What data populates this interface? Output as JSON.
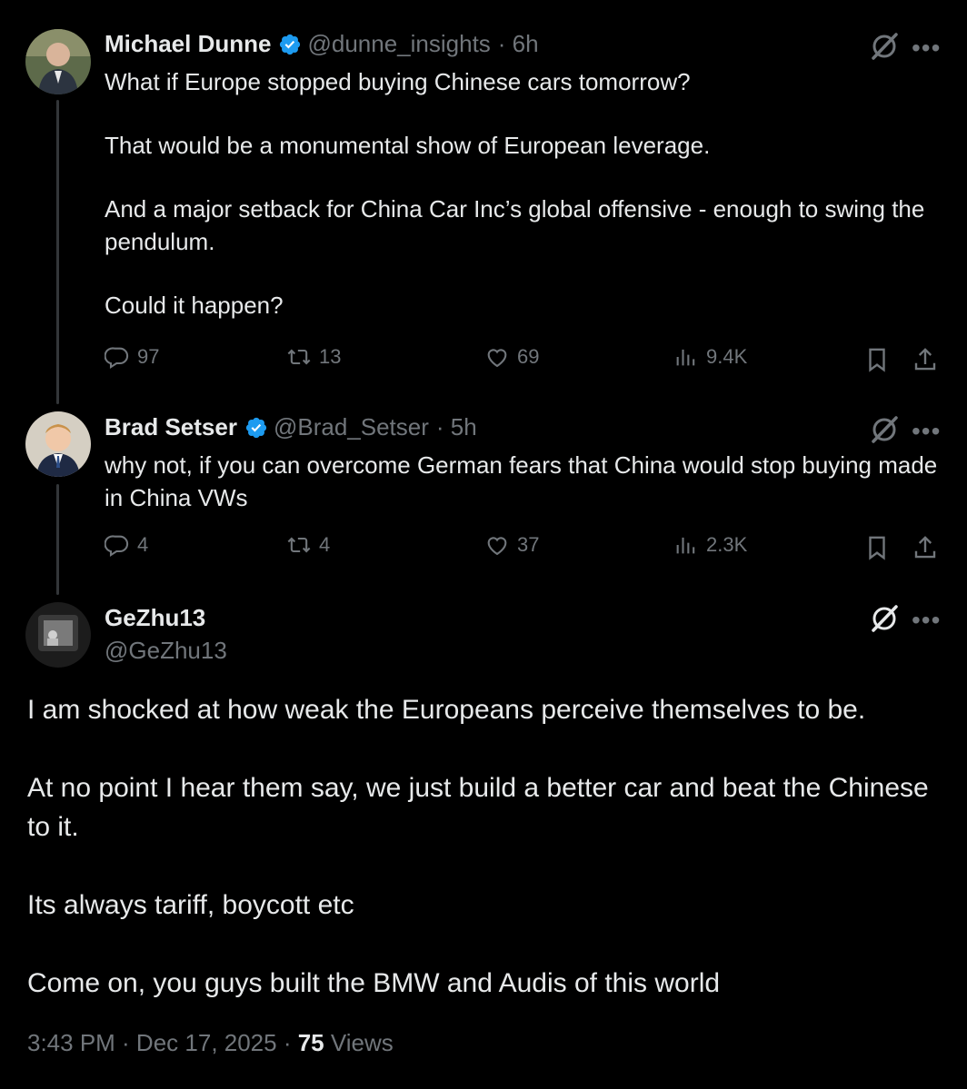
{
  "tweets": [
    {
      "name": "Michael Dunne",
      "handle": "@dunne_insights",
      "time": "· 6h",
      "paragraphs": [
        "What if Europe stopped buying Chinese cars tomorrow?",
        "That would be a monumental show of European leverage.",
        "And a major setback for China Car Inc’s global offensive - enough to swing the pendulum.",
        "Could  it happen?"
      ],
      "replies": "97",
      "reposts": "13",
      "likes": "69",
      "views": "9.4K"
    },
    {
      "name": "Brad Setser",
      "handle": "@Brad_Setser",
      "time": "· 5h",
      "paragraphs": [
        "why not, if you can overcome German fears that China would stop buying made in China VWs"
      ],
      "replies": "4",
      "reposts": "4",
      "likes": "37",
      "views": "2.3K"
    }
  ],
  "main": {
    "name": "GeZhu13",
    "handle": "@GeZhu13",
    "paragraphs": [
      "I am shocked at how weak the Europeans perceive themselves to be.",
      "At no point I hear them say, we just build a better car and beat the Chinese to it.",
      "Its always tariff, boycott etc",
      "Come on, you guys built the BMW and Audis of this world"
    ],
    "footer_time": "3:43 PM · Dec 17, 2025 · ",
    "footer_views_count": "75",
    "footer_views_label": " Views"
  },
  "icons": {
    "more": "more-dots-icon",
    "grok": "grok-slash-icon",
    "verified": "verified-badge-icon",
    "reply": "reply-icon",
    "repost": "repost-icon",
    "like": "like-icon",
    "views": "views-icon",
    "bookmark": "bookmark-icon",
    "share": "share-icon"
  },
  "colors": {
    "background": "#000000",
    "text": "#e7e9ea",
    "muted": "#71767b",
    "verified": "#1d9bf0"
  }
}
